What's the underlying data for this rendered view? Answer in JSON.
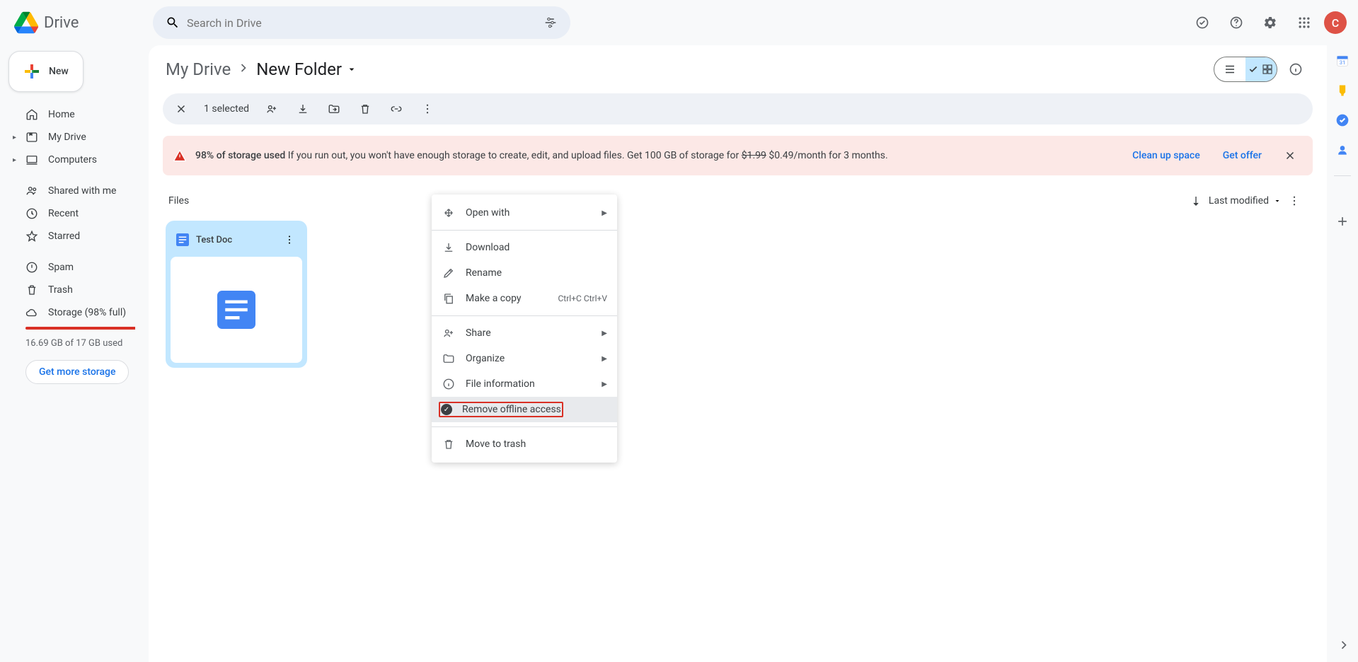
{
  "app_name": "Drive",
  "search": {
    "placeholder": "Search in Drive"
  },
  "header_avatar": "C",
  "new_button": "New",
  "nav": {
    "home": "Home",
    "my_drive": "My Drive",
    "computers": "Computers",
    "shared": "Shared with me",
    "recent": "Recent",
    "starred": "Starred",
    "spam": "Spam",
    "trash": "Trash",
    "storage": "Storage (98% full)"
  },
  "storage": {
    "text": "16.69 GB of 17 GB used",
    "more_btn": "Get more storage",
    "fill_pct": 98
  },
  "breadcrumb": {
    "parent": "My Drive",
    "current": "New Folder"
  },
  "selection": {
    "count": "1 selected"
  },
  "banner": {
    "lead": "98% of storage used",
    "body_a": " If you run out, you won't have enough storage to create, edit, and upload files. Get 100 GB of storage for ",
    "strike": "$1.99",
    "body_b": " $0.49/month for 3 months.",
    "cleanup": "Clean up space",
    "offer": "Get offer"
  },
  "files_section": {
    "label": "Files",
    "sort": "Last modified"
  },
  "file": {
    "name": "Test Doc"
  },
  "context_menu": {
    "open_with": "Open with",
    "download": "Download",
    "rename": "Rename",
    "make_copy": "Make a copy",
    "make_copy_shortcut": "Ctrl+C Ctrl+V",
    "share": "Share",
    "organize": "Organize",
    "file_info": "File information",
    "offline": "Remove offline access",
    "trash": "Move to trash"
  }
}
